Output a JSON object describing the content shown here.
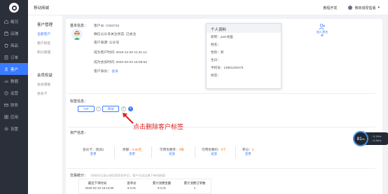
{
  "topbar": {
    "shop_name": "移动商城",
    "help": "教程开发",
    "user": "微商城零售版",
    "caret": "▾"
  },
  "sidebar": {
    "items": [
      {
        "label": "概况",
        "icon": "home-icon"
      },
      {
        "label": "店铺",
        "icon": "store-icon"
      },
      {
        "label": "商品",
        "icon": "goods-icon"
      },
      {
        "label": "订单",
        "icon": "order-icon"
      },
      {
        "label": "客户",
        "icon": "customer-icon",
        "active": true
      },
      {
        "label": "数据",
        "icon": "data-icon"
      },
      {
        "label": "运营",
        "icon": "operation-icon"
      },
      {
        "label": "财务",
        "icon": "finance-icon"
      },
      {
        "label": "应用",
        "icon": "app-icon"
      },
      {
        "label": "设置",
        "icon": "settings-icon"
      }
    ]
  },
  "submenu": {
    "group1_title": "客户管理",
    "group1_items": [
      "全部客户",
      "客户标签",
      "积分管理"
    ],
    "group2_title": "会员权益",
    "group2_items": [
      "会员等级",
      "会员卡"
    ]
  },
  "basic": {
    "section_label": "基本信息：",
    "customer_id": "客户ID: Y334722",
    "wechat": "微信公众号关注状态: 已关注",
    "source": "客户来源: 公众号",
    "become_customer": "成为客户时间: 2019-12-20 11:31:12",
    "become_member": "成为会员时间: 2020-02-04 15:05:52",
    "identity_label": "客户身份：",
    "identity_link": "会员"
  },
  "popup": {
    "title": "个人资料",
    "rows": [
      "昵称：yam龙猫",
      "姓名：",
      "性别：男",
      "生日：",
      "手机号：13861226476",
      "标签："
    ]
  },
  "add_friend": {
    "label_line1": "加入黑名",
    "label_line2": "单"
  },
  "tags": {
    "section_label": "标签信息：",
    "tag1": "VIP",
    "tag1_close": "×",
    "tag2": "测试",
    "tag2_close": "×",
    "minus": "−",
    "plus": "+"
  },
  "annotation": {
    "text": "点击删除客户标签"
  },
  "assets": {
    "section_label": "资产信息：",
    "member_card_label": "会员卡：",
    "member_card_value": "测试2",
    "member_card_link": "变更",
    "balance_label": "余额：",
    "balance_value": "0.00元",
    "balance_link": "变更",
    "coupon_label": "可用优惠券：",
    "coupon_value": "0张",
    "coupon_link": "发放",
    "code_label": "可用优惠码：",
    "code_value": "0个",
    "code_link": "发放",
    "points_label": "积分：",
    "points_value": "2",
    "points_link": "变更"
  },
  "trade": {
    "section_label": "交易统计：",
    "note": "（系统仅记录从使用商家软件后，客户在该店铺下单的数据）",
    "columns": [
      "最近下单时间",
      "客单价",
      "累计消费金额",
      "累计消费订单数"
    ],
    "values": [
      "2020-02-10 15:13:50",
      "¥ 0.01",
      "¥ 0.01",
      "1"
    ]
  },
  "gauge": {
    "percent": "81",
    "unit": "%",
    "up": "0.1K/s",
    "down": "0.3K/s"
  },
  "colors": {
    "primary": "#3a7bff",
    "sidebar": "#2b2f3a",
    "annotation": "#e02020",
    "orange": "#ff6b00"
  }
}
